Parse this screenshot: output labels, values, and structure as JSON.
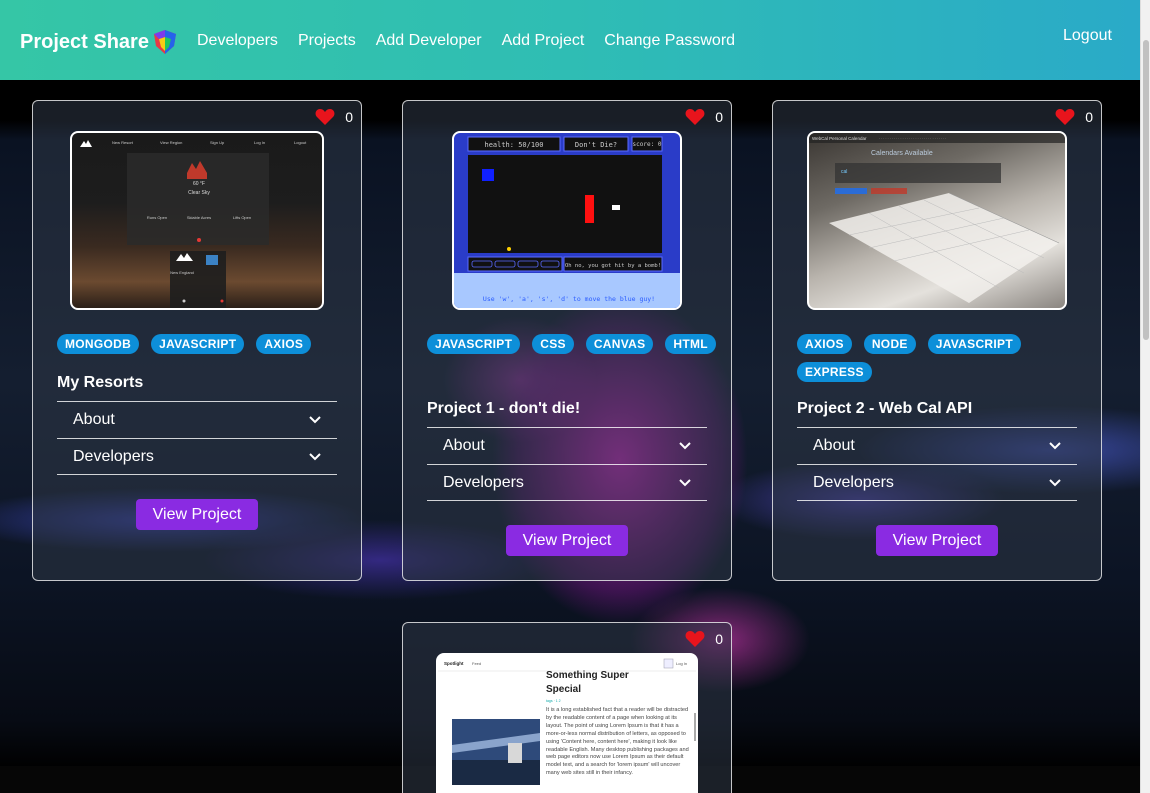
{
  "navbar": {
    "brand": "Project Share",
    "links": [
      "Developers",
      "Projects",
      "Add Developer",
      "Add Project",
      "Change Password"
    ],
    "logout": "Logout"
  },
  "projects": [
    {
      "likes": "0",
      "tags": [
        "MONGODB",
        "JAVASCRIPT",
        "AXIOS"
      ],
      "title": "My Resorts",
      "about_label": "About",
      "developers_label": "Developers",
      "button": "View Project",
      "thumb": {
        "nav": [
          "New Resort",
          "View Region",
          "Sign Up",
          "Log In",
          "Logout"
        ],
        "temp": "60 °F",
        "cond": "Clear Sky",
        "stats": [
          "Runs Open",
          "Skiable Acres",
          "Lifts Open"
        ],
        "region": "New England"
      }
    },
    {
      "likes": "0",
      "tags": [
        "JAVASCRIPT",
        "CSS",
        "CANVAS",
        "HTML"
      ],
      "title": "Project 1 - don't die!",
      "about_label": "About",
      "developers_label": "Developers",
      "button": "View Project",
      "thumb": {
        "health": "health: 50/100",
        "dontdie": "Don't Die?",
        "score": "score: 0",
        "message": "Oh no, you got hit by a bomb!",
        "instructions": "Use 'w', 'a', 's', 'd' to move the blue guy!"
      }
    },
    {
      "likes": "0",
      "tags": [
        "AXIOS",
        "NODE",
        "JAVASCRIPT",
        "EXPRESS"
      ],
      "title": "Project 2 - Web Cal API",
      "about_label": "About",
      "developers_label": "Developers",
      "button": "View Project",
      "thumb": {
        "header": "WebCal Personal Calendar",
        "sub": "Calendars Available"
      }
    },
    {
      "likes": "0",
      "tags": [],
      "title": "",
      "thumb": {
        "brand": "Spotlight",
        "feed": "Feed",
        "login": "Log In",
        "heading": "Something Super Special",
        "body": "It is a long established fact that a reader will be distracted by the readable content of a page when looking at its layout. The point of using Lorem Ipsum is that it has a more-or-less normal distribution of letters, as opposed to using 'Content here, content here', making it look like readable English. Many desktop publishing packages and web page editors now use Lorem Ipsum as their default model text, and a search for 'lorem ipsum' will uncover many web sites still in their infancy."
      }
    }
  ],
  "colors": {
    "navbar_start": "#35c6a6",
    "navbar_end": "#2aaac8",
    "tag": "#0d8fd9",
    "button": "#8a2be2",
    "heart": "#e8141c"
  }
}
